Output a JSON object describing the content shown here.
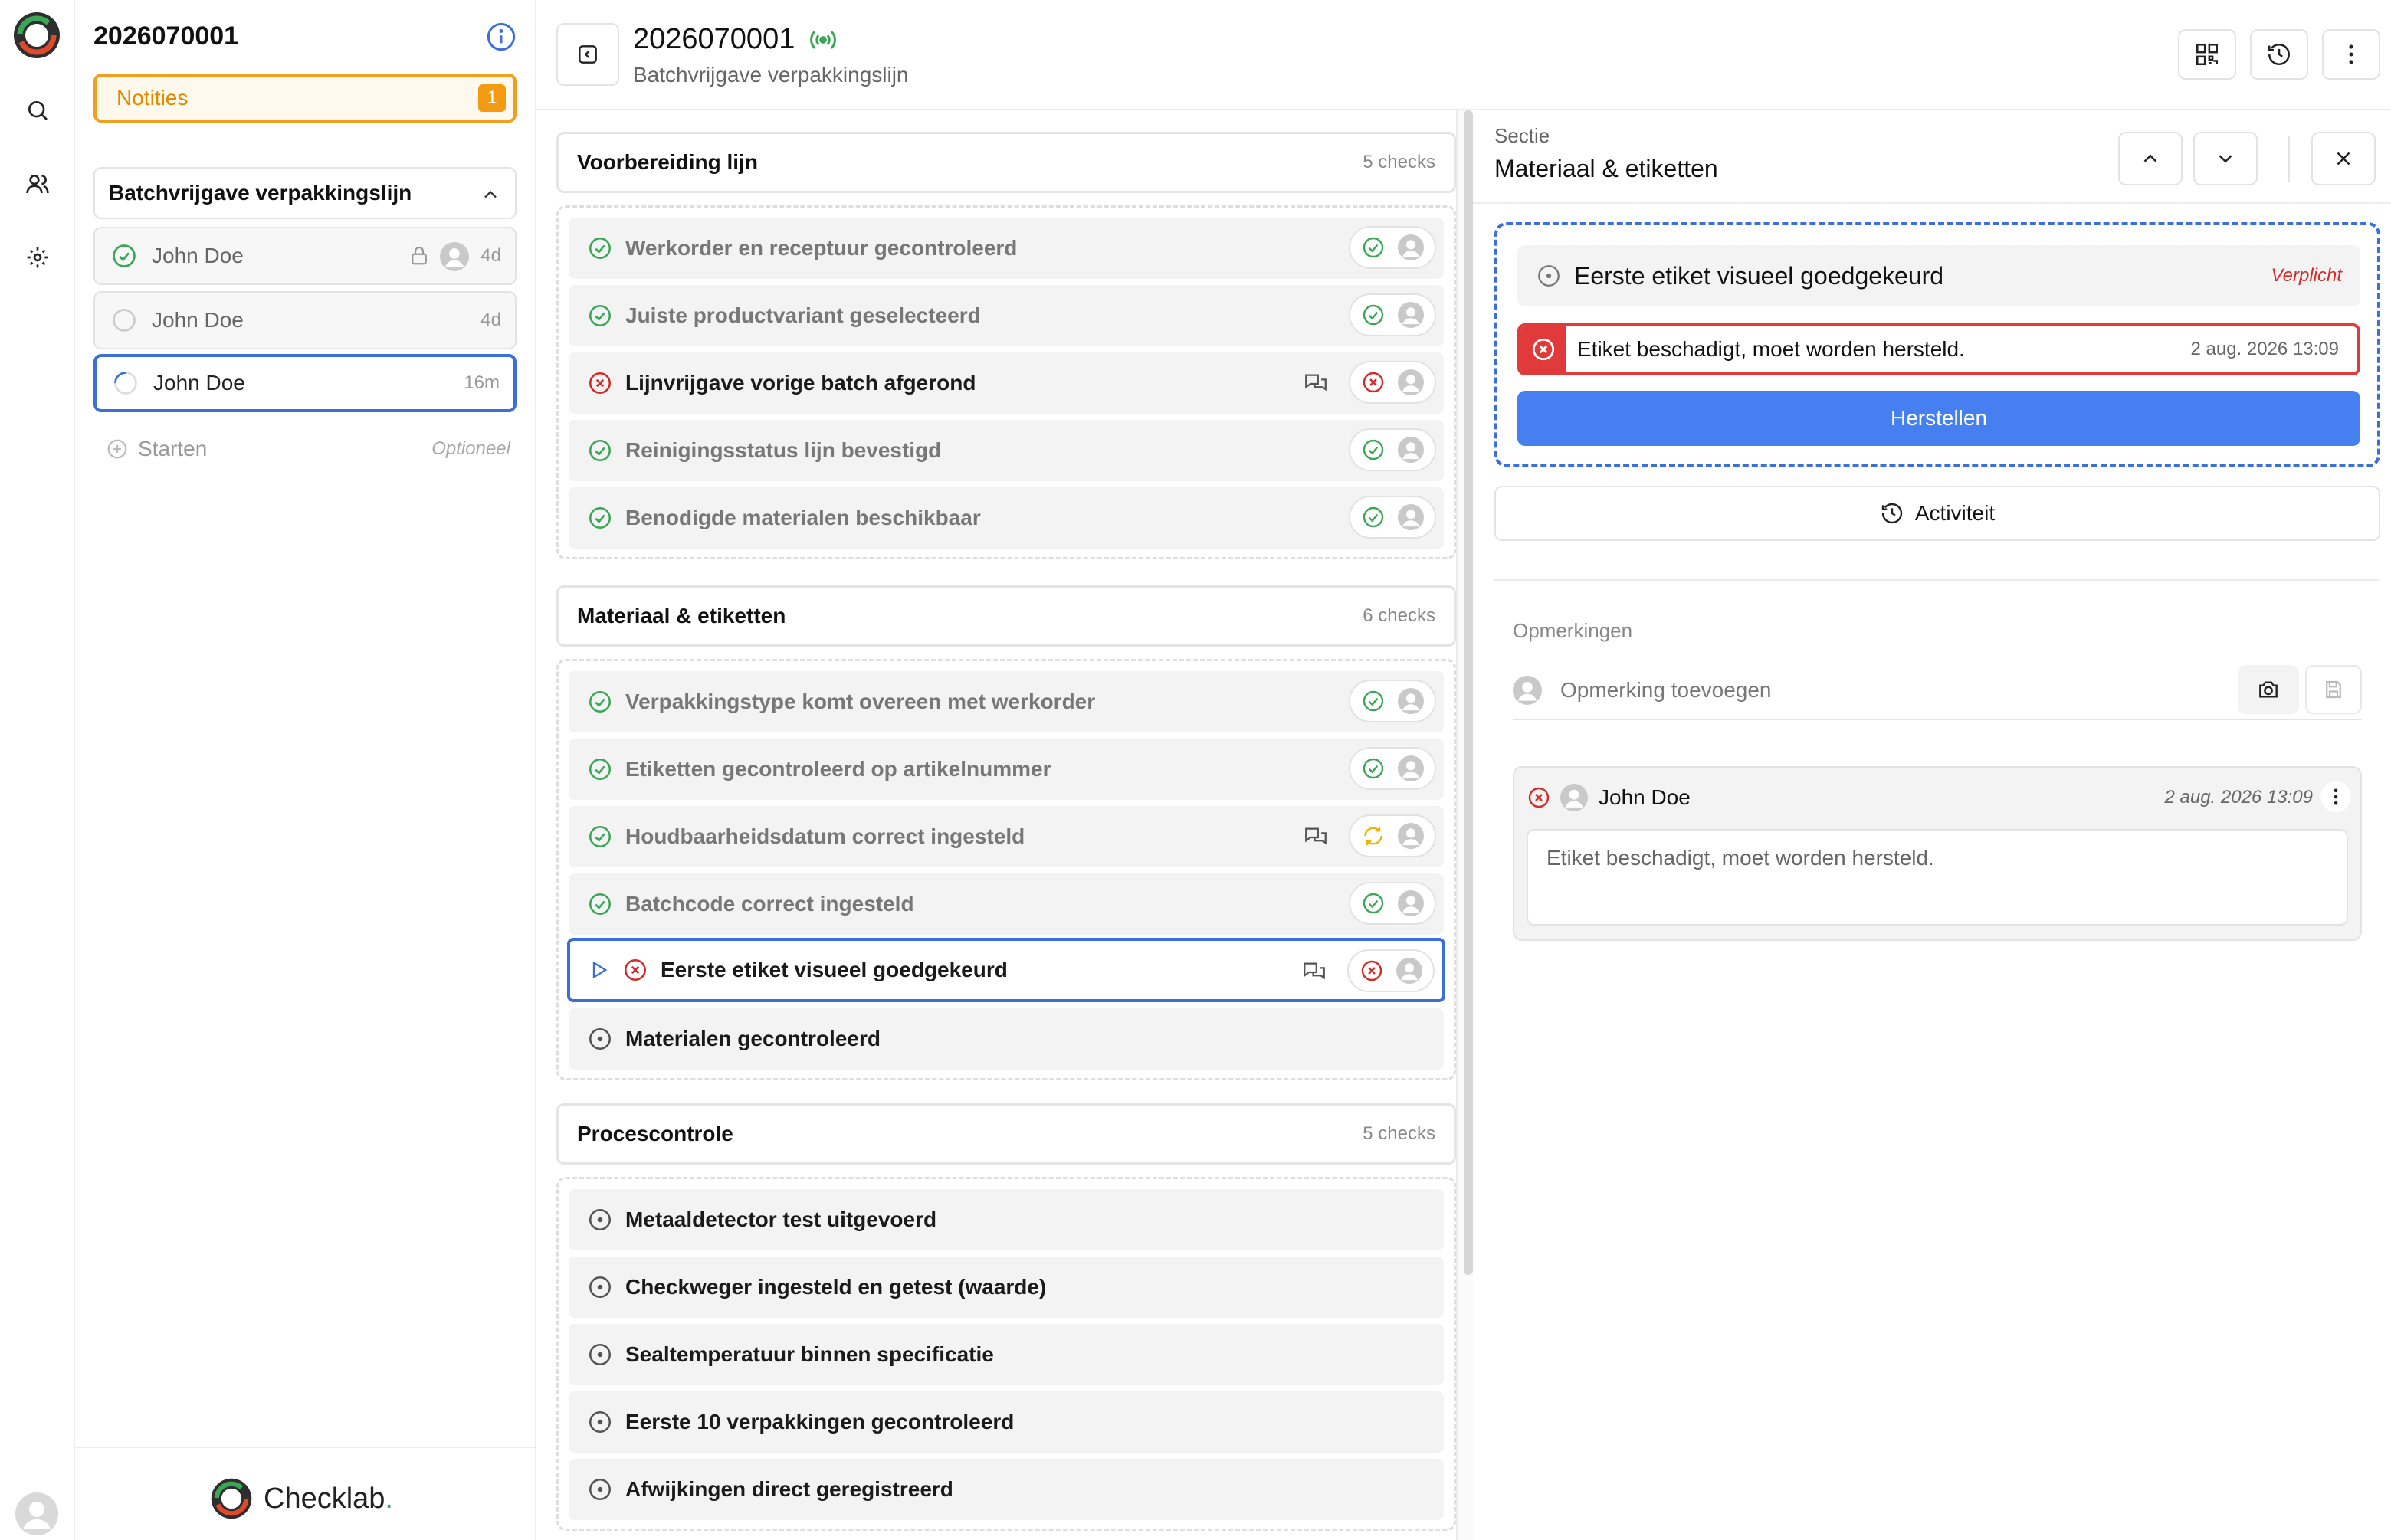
{
  "colors": {
    "accent_blue": "#3d6fd8",
    "button_blue": "#4680f0",
    "success_green": "#3aa757",
    "error_red": "#e03a3a",
    "warning_orange": "#f0a020"
  },
  "sidebar": {
    "title": "2026070001",
    "notes_label": "Notities",
    "notes_count": "1",
    "group_title": "Batchvrijgave verpakkingslijn",
    "runs": [
      {
        "name": "John Doe",
        "age": "4d",
        "status": "done",
        "locked": true
      },
      {
        "name": "John Doe",
        "age": "4d",
        "status": "open",
        "locked": false
      },
      {
        "name": "John Doe",
        "age": "16m",
        "status": "in-progress",
        "locked": false
      }
    ],
    "start_label": "Starten",
    "start_optional": "Optioneel",
    "brand": "Checklab",
    "brand_dot": "."
  },
  "header": {
    "title": "2026070001",
    "subtitle": "Batchvrijgave verpakkingslijn"
  },
  "sections": [
    {
      "title": "Voorbereiding lijn",
      "count": "5 checks",
      "items": [
        {
          "label": "Werkorder en receptuur gecontroleerd",
          "status": "ok"
        },
        {
          "label": "Juiste productvariant geselecteerd",
          "status": "ok"
        },
        {
          "label": "Lijnvrijgave vorige batch afgerond",
          "status": "fail"
        },
        {
          "label": "Reinigingsstatus lijn bevestigd",
          "status": "ok"
        },
        {
          "label": "Benodigde materialen beschikbaar",
          "status": "ok"
        }
      ]
    },
    {
      "title": "Materiaal & etiketten",
      "count": "6 checks",
      "items": [
        {
          "label": "Verpakkingstype komt overeen met werkorder",
          "status": "ok"
        },
        {
          "label": "Etiketten gecontroleerd op artikelnummer",
          "status": "ok"
        },
        {
          "label": "Houdbaarheidsdatum correct ingesteld",
          "status": "retry"
        },
        {
          "label": "Batchcode correct ingesteld",
          "status": "ok"
        },
        {
          "label": "Eerste etiket visueel goedgekeurd",
          "status": "fail"
        },
        {
          "label": "Materialen gecontroleerd",
          "status": "open"
        }
      ]
    },
    {
      "title": "Procescontrole",
      "count": "5 checks",
      "items": [
        {
          "label": "Metaaldetector test uitgevoerd",
          "status": "open"
        },
        {
          "label": "Checkweger ingesteld en getest (waarde)",
          "status": "open"
        },
        {
          "label": "Sealtemperatuur binnen specificatie",
          "status": "open"
        },
        {
          "label": "Eerste 10 verpakkingen gecontroleerd",
          "status": "open"
        },
        {
          "label": "Afwijkingen direct geregistreerd",
          "status": "open"
        }
      ]
    }
  ],
  "detail": {
    "section_label": "Sectie",
    "section_title": "Materiaal & etiketten",
    "check_title": "Eerste etiket visueel goedgekeurd",
    "required_label": "Verplicht",
    "error_text": "Etiket beschadigt, moet worden hersteld.",
    "error_date": "2 aug. 2026 13:09",
    "repair_button": "Herstellen",
    "activity_button": "Activiteit",
    "remarks_label": "Opmerkingen",
    "remark_placeholder": "Opmerking toevoegen",
    "comment": {
      "author": "John Doe",
      "date": "2 aug. 2026 13:09",
      "text": "Etiket beschadigt, moet worden hersteld."
    }
  }
}
